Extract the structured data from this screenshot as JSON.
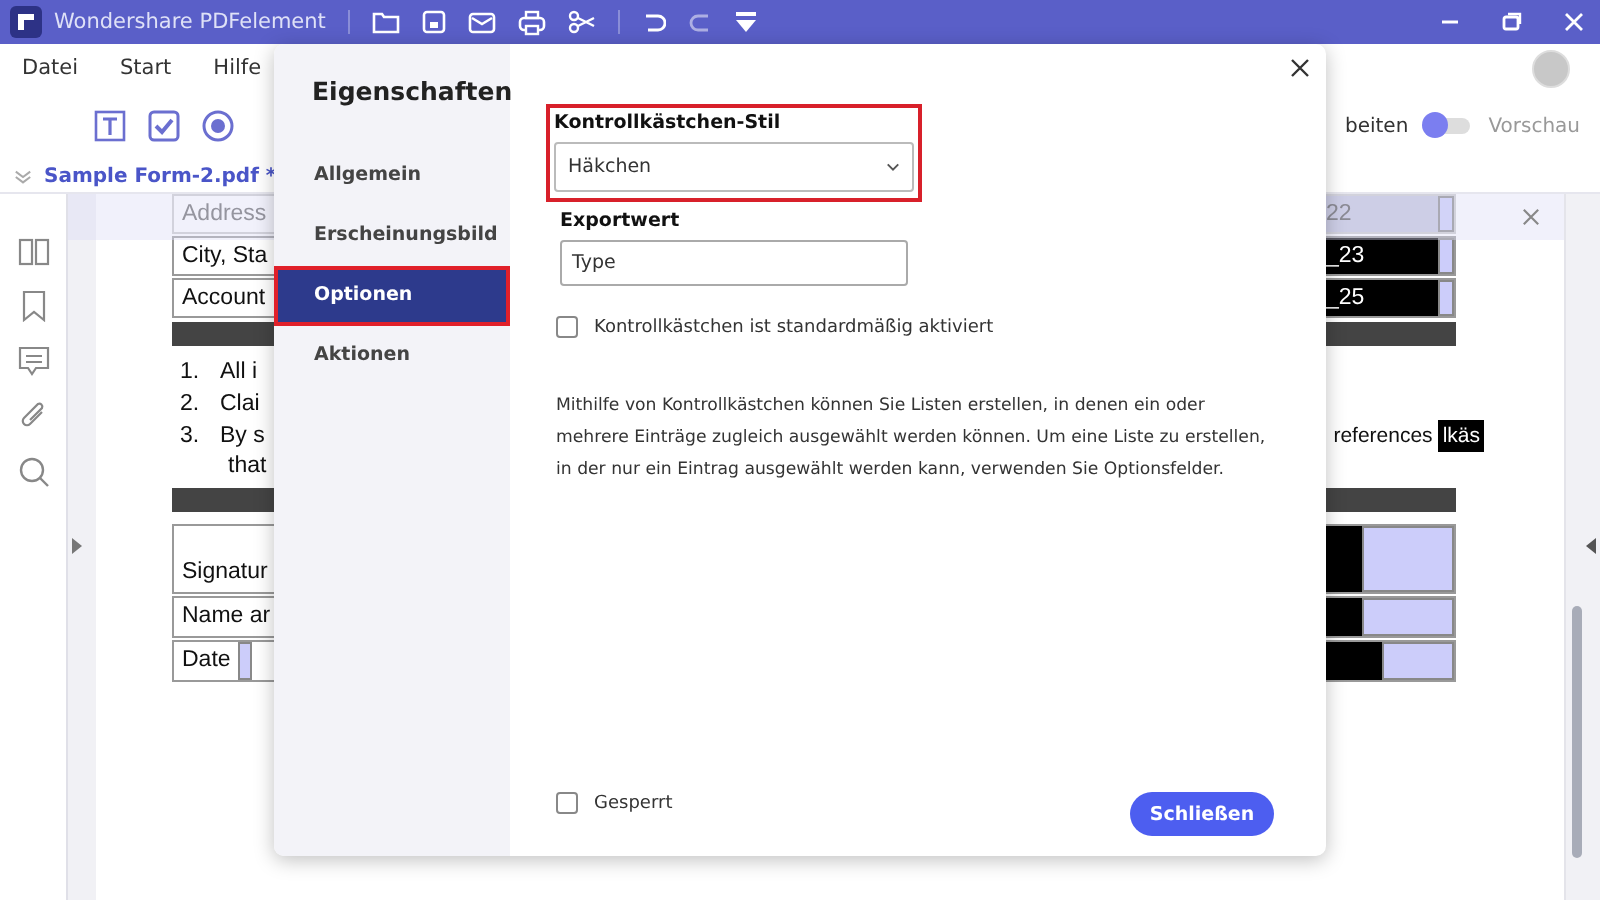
{
  "title_bar": {
    "app_name": "Wondershare PDFelement"
  },
  "menu": [
    {
      "label": "Datei"
    },
    {
      "label": "Start"
    },
    {
      "label": "Hilfe"
    }
  ],
  "toolbar": {
    "mode_left": "beiten",
    "mode_right": "Vorschau",
    "preview": false
  },
  "document_tab": {
    "label": "Sample Form-2.pdf *"
  },
  "document": {
    "rows": [
      {
        "kind": "field",
        "label": "Address",
        "value": "22"
      },
      {
        "kind": "field",
        "label": "City, Sta",
        "value": "_23"
      },
      {
        "kind": "field",
        "label": "Account",
        "value": "_25"
      },
      {
        "kind": "bar"
      },
      {
        "kind": "list",
        "number": "1.",
        "text": "All i"
      },
      {
        "kind": "list",
        "number": "2.",
        "text": "Clai"
      },
      {
        "kind": "list",
        "number": "3.",
        "text": "By s",
        "tail": "references",
        "tag": "lkäs"
      },
      {
        "kind": "cont",
        "text": "that"
      },
      {
        "kind": "bar"
      },
      {
        "kind": "sign",
        "label": "Signatur"
      },
      {
        "kind": "sign",
        "label": "Name ar"
      },
      {
        "kind": "date",
        "label": "Date"
      }
    ]
  },
  "dialog": {
    "title": "Eigenschaften",
    "nav": [
      {
        "label": "Allgemein",
        "selected": false,
        "highlighted": false
      },
      {
        "label": "Erscheinungsbild",
        "selected": false,
        "highlighted": false
      },
      {
        "label": "Optionen",
        "selected": true,
        "highlighted": true
      },
      {
        "label": "Aktionen",
        "selected": false,
        "highlighted": false
      }
    ],
    "style_field": {
      "label": "Kontrollkästchen-Stil",
      "value": "Häkchen",
      "highlighted": true
    },
    "export_field": {
      "label": "Exportwert",
      "value": "Type"
    },
    "default_checked": {
      "label": "Kontrollkästchen ist standardmäßig aktiviert",
      "checked": false
    },
    "help_text": "Mithilfe von Kontrollkästchen können Sie Listen erstellen, in denen ein oder mehrere Einträge zugleich ausgewählt werden können. Um eine Liste zu erstellen, in der nur ein Eintrag ausgewählt werden kann, verwenden Sie Optionsfelder.",
    "locked": {
      "label": "Gesperrt",
      "checked": false
    },
    "close_button": "Schließen"
  }
}
